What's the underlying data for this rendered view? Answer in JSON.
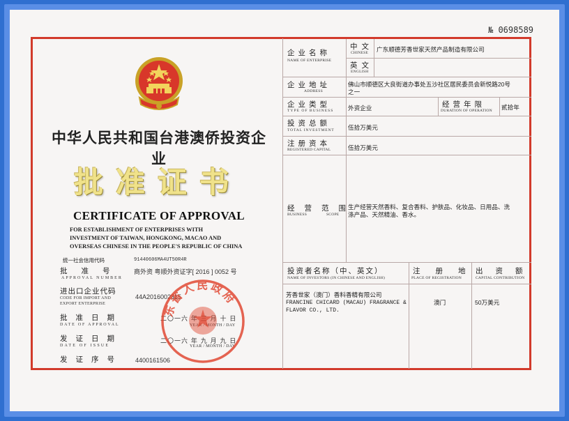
{
  "serial": "№ 0698589",
  "left": {
    "title_cn": "中华人民共和国台港澳侨投资企业",
    "title_big": "批准证书",
    "title_en": "CERTIFICATE OF APPROVAL",
    "subtitle_en": [
      "FOR    ESTABLISHMENT    OF    ENTERPRISES    WITH",
      "INVESTMENT OF TAIWAN, HONGKONG, MACAO AND",
      "OVERSEAS CHINESE IN THE PEOPLE'S REPUBLIC OF CHINA"
    ],
    "fields": {
      "credit_code_label": "统一社会信用代码",
      "credit_code_value": "91440606MA4UT50R4R",
      "approval_number_label": "批准号",
      "approval_number_en": "APPROVAL NUMBER",
      "approval_number_value": "商外资 粤顺外资证字[ 2016 ] 0052 号",
      "import_export_label": "进出口企业代码",
      "import_export_en_1": "CODE FOR IMPORT AND",
      "import_export_en_2": "EXPORT ENTERPRISE",
      "import_export_value": "44A2016002315",
      "approval_date_label": "批准日期",
      "approval_date_en": "DATE OF APPROVAL",
      "approval_date_value": "二〇一六 年 三 月 十 日",
      "approval_date_ymd": "YEAR  /  MONTH  /  DAY",
      "issue_date_label": "发证日期",
      "issue_date_en": "DATE OF ISSUE",
      "issue_date_value": "二〇一六 年 九 月 九 日",
      "issue_date_ymd": "YEAR  /  MONTH  /  DAY",
      "cert_number_label": "发证序号",
      "cert_number_value": "4400161506"
    },
    "seal_text": "东省人民政府"
  },
  "right": {
    "enterprise_name_label": "企业名称",
    "enterprise_name_en": "NAME OF ENTERPRISE",
    "chinese_label": "中文",
    "chinese_en": "CHINESE",
    "english_label": "英文",
    "english_en": "ENGLISH",
    "enterprise_name_cn": "广东顺德芳香世家天然产品制造有限公司",
    "address_label": "企业地址",
    "address_en": "ADDRESS",
    "address_value_1": "佛山市顺德区大良街道办事处五沙社区居民委员会新悦路20号",
    "address_value_2": "之一",
    "type_label": "企业类型",
    "type_en": "TYPE OF BUSINESS",
    "type_value": "外资企业",
    "duration_label": "经营年限",
    "duration_en": "DURATION OF OPERATION",
    "duration_value": "贰拾年",
    "total_investment_label": "投资总额",
    "total_investment_en": "TOTAL INVESTMENT",
    "total_investment_value": "伍拾万美元",
    "registered_capital_label": "注册资本",
    "registered_capital_en": "REGISTERED CAPITAL",
    "registered_capital_value": "伍拾万美元",
    "scope_label": "经营范围",
    "scope_en_1": "BUSINESS",
    "scope_en_2": "SCOPE",
    "scope_value_1": "生产经营天然香料、复合香料、护肤品、化妆品、日用品、洗",
    "scope_value_2": "涤产品、天然精油、香水。",
    "investors_header": "投资者名称（中、英文）",
    "investors_header_en": "NAME OF INVESTORS (IN CHINESE AND ENGLISH)",
    "place_header": "注册地",
    "place_header_en": "PLACE OF REGISTRATION",
    "capital_header": "出资额",
    "capital_header_en": "CAPITAL CONTRIBUTION",
    "investor_1_cn": "芳香世家（澳门）香料香精有限公司",
    "investor_1_en_1": "FRANCINE CHICARD (MACAU) FRAGRANCE &",
    "investor_1_en_2": "FLAVOR CO., LTD.",
    "investor_1_place": "澳门",
    "investor_1_capital": "50万美元"
  },
  "colors": {
    "border_red": "#d23a2b",
    "frame_blue": "#2f6fd0",
    "gold": "#f0e28a",
    "seal_red": "#e0442e"
  }
}
